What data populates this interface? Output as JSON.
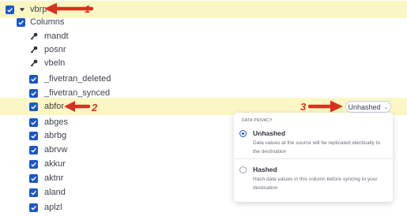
{
  "table": {
    "name": "vbrp"
  },
  "columns_group": {
    "label": "Columns"
  },
  "columns": [
    {
      "name": "mandt",
      "kind": "key"
    },
    {
      "name": "posnr",
      "kind": "key"
    },
    {
      "name": "vbeln",
      "kind": "key"
    },
    {
      "name": "_fivetran_deleted",
      "kind": "checkbox"
    },
    {
      "name": "_fivetran_synced",
      "kind": "checkbox"
    },
    {
      "name": "abfor",
      "kind": "checkbox"
    },
    {
      "name": "abges",
      "kind": "checkbox"
    },
    {
      "name": "abrbg",
      "kind": "checkbox"
    },
    {
      "name": "abrvw",
      "kind": "checkbox"
    },
    {
      "name": "akkur",
      "kind": "checkbox"
    },
    {
      "name": "aktnr",
      "kind": "checkbox"
    },
    {
      "name": "aland",
      "kind": "checkbox"
    },
    {
      "name": "aplzl",
      "kind": "checkbox"
    }
  ],
  "hash_select": {
    "value": "Unhashed",
    "icon": "chevron-down-icon"
  },
  "callouts": [
    "1",
    "2",
    "3"
  ],
  "privacy_panel": {
    "header": "DATA PRIVACY",
    "options": [
      {
        "title": "Unhashed",
        "description": "Data values at the source will be replicated identically to the destination",
        "selected": true
      },
      {
        "title": "Hashed",
        "description": "Hash data values in this column before syncing to your destination",
        "selected": false
      }
    ]
  },
  "colors": {
    "accent": "#1a57c9",
    "highlight": "#fbf7c4",
    "callout": "#d6321f"
  }
}
